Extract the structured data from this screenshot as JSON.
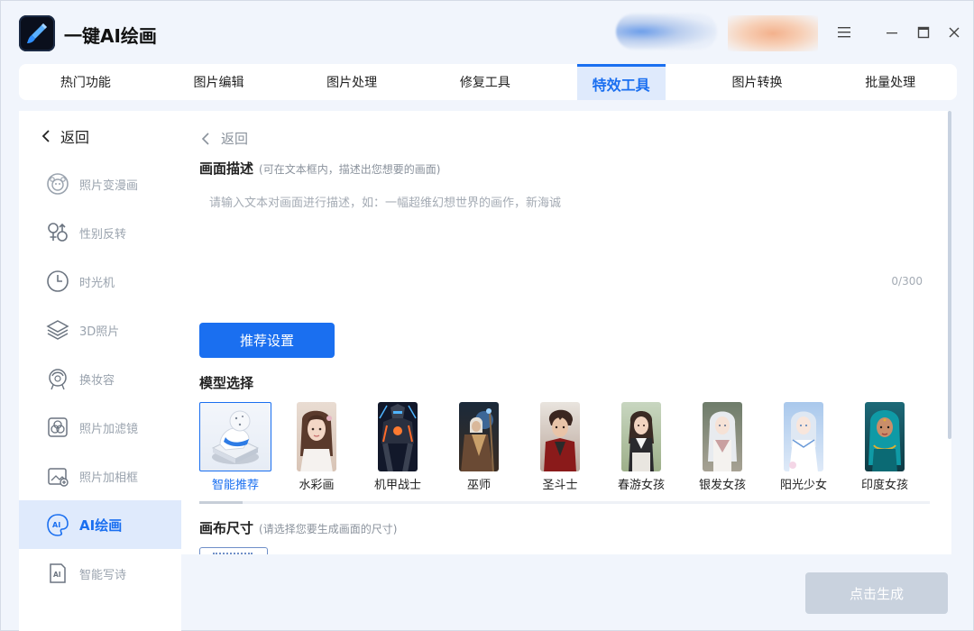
{
  "app": {
    "title": "一键AI绘画"
  },
  "window_controls": {
    "menu": "☰",
    "minimize": "—",
    "maximize": "☐",
    "close": "✕"
  },
  "tabs": [
    {
      "label": "热门功能",
      "active": false
    },
    {
      "label": "图片编辑",
      "active": false
    },
    {
      "label": "图片处理",
      "active": false
    },
    {
      "label": "修复工具",
      "active": false
    },
    {
      "label": "特效工具",
      "active": true
    },
    {
      "label": "图片转换",
      "active": false
    },
    {
      "label": "批量处理",
      "active": false
    }
  ],
  "sidebar": {
    "back_label": "返回",
    "items": [
      {
        "label": "照片变漫画",
        "icon": "cartoon-face-icon",
        "active": false
      },
      {
        "label": "性别反转",
        "icon": "gender-icon",
        "active": false
      },
      {
        "label": "时光机",
        "icon": "clock-icon",
        "active": false
      },
      {
        "label": "3D照片",
        "icon": "layers-icon",
        "active": false
      },
      {
        "label": "换妆容",
        "icon": "makeup-face-icon",
        "active": false
      },
      {
        "label": "照片加滤镜",
        "icon": "filter-icon",
        "active": false
      },
      {
        "label": "照片加相框",
        "icon": "frame-icon",
        "active": false
      },
      {
        "label": "AI绘画",
        "icon": "ai-paint-icon",
        "active": true
      },
      {
        "label": "智能写诗",
        "icon": "ai-document-icon",
        "active": false
      }
    ]
  },
  "main": {
    "back_label": "返回",
    "description": {
      "title": "画面描述",
      "hint": "(可在文本框内，描述出您想要的画面)",
      "placeholder": "请输入文本对画面进行描述，如：一幅超维幻想世界的画作，新海诚",
      "value": "",
      "counter": "0/300"
    },
    "recommend_button": "推荐设置",
    "model_section": {
      "title": "模型选择",
      "models": [
        {
          "label": "智能推荐",
          "selected": true
        },
        {
          "label": "水彩画",
          "selected": false
        },
        {
          "label": "机甲战士",
          "selected": false
        },
        {
          "label": "巫师",
          "selected": false
        },
        {
          "label": "圣斗士",
          "selected": false
        },
        {
          "label": "春游女孩",
          "selected": false
        },
        {
          "label": "银发女孩",
          "selected": false
        },
        {
          "label": "阳光少女",
          "selected": false
        },
        {
          "label": "印度女孩",
          "selected": false
        }
      ]
    },
    "canvas_section": {
      "title": "画布尺寸",
      "hint": "(请选择您要生成画面的尺寸)"
    }
  },
  "generate_button": "点击生成",
  "colors": {
    "accent": "#1a6ff0",
    "active_bg": "#dfeafc",
    "disabled_button": "#c9d2de"
  }
}
